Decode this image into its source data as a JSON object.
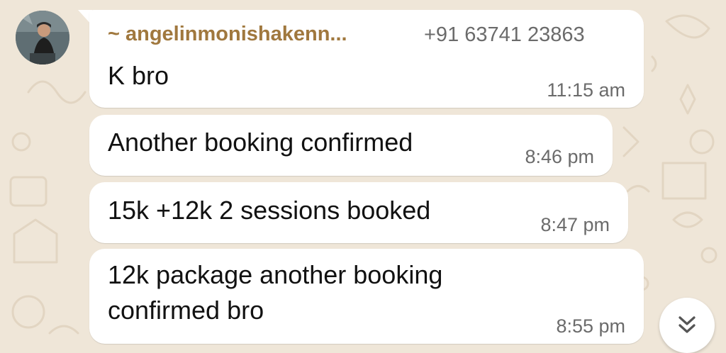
{
  "chat": {
    "messages": [
      {
        "sender_name": "~ angelinmonishakenn...",
        "sender_phone": "+91 63741 23863",
        "text": "K bro",
        "time": "11:15 am"
      },
      {
        "text": "Another booking confirmed",
        "time": "8:46 pm"
      },
      {
        "text": "15k +12k 2 sessions booked",
        "time": "8:47 pm"
      },
      {
        "text_line1": "12k package another booking",
        "text_line2": "confirmed bro",
        "time": "8:55 pm"
      }
    ],
    "scroll_button_icon": "double-chevron-down-icon"
  },
  "colors": {
    "background": "#efe6d8",
    "bubble": "#ffffff",
    "sender_name": "#a0783e",
    "meta_text": "#6b6b6b",
    "message_text": "#111111"
  }
}
